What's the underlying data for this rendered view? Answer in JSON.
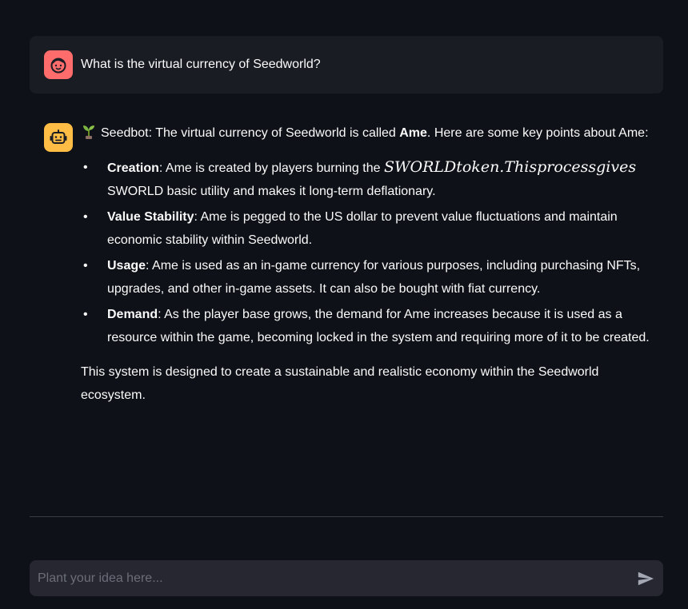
{
  "user_message": {
    "text": "What is the virtual currency of Seedworld?",
    "avatar_color": "#ff6c6c",
    "avatar_icon": "smiling-face-icon"
  },
  "bot_message": {
    "avatar_color": "#ffbd45",
    "avatar_icon": "robot-face-icon",
    "intro_prefix": "Seedbot: The virtual currency of Seedworld is called ",
    "intro_bold": "Ame",
    "intro_suffix": ". Here are some key points about Ame:",
    "sprout_icon": "seedling-icon",
    "points": [
      {
        "title": "Creation",
        "text_before": ": Ame is created by players burning the ",
        "math": "SWORLDtoken.Thisprocessgives",
        "text_after": " SWORLD basic utility and makes it long-term deflationary."
      },
      {
        "title": "Value Stability",
        "text": ": Ame is pegged to the US dollar to prevent value fluctuations and maintain economic stability within Seedworld."
      },
      {
        "title": "Usage",
        "text": ": Ame is used as an in-game currency for various purposes, including purchasing NFTs, upgrades, and other in-game assets. It can also be bought with fiat currency."
      },
      {
        "title": "Demand",
        "text": ": As the player base grows, the demand for Ame increases because it is used as a resource within the game, becoming locked in the system and requiring more of it to be created."
      }
    ],
    "closing": "This system is designed to create a sustainable and realistic economy within the Seedworld ecosystem."
  },
  "chat_input": {
    "placeholder": "Plant your idea here...",
    "value": "",
    "send_icon": "send-arrow-icon"
  }
}
